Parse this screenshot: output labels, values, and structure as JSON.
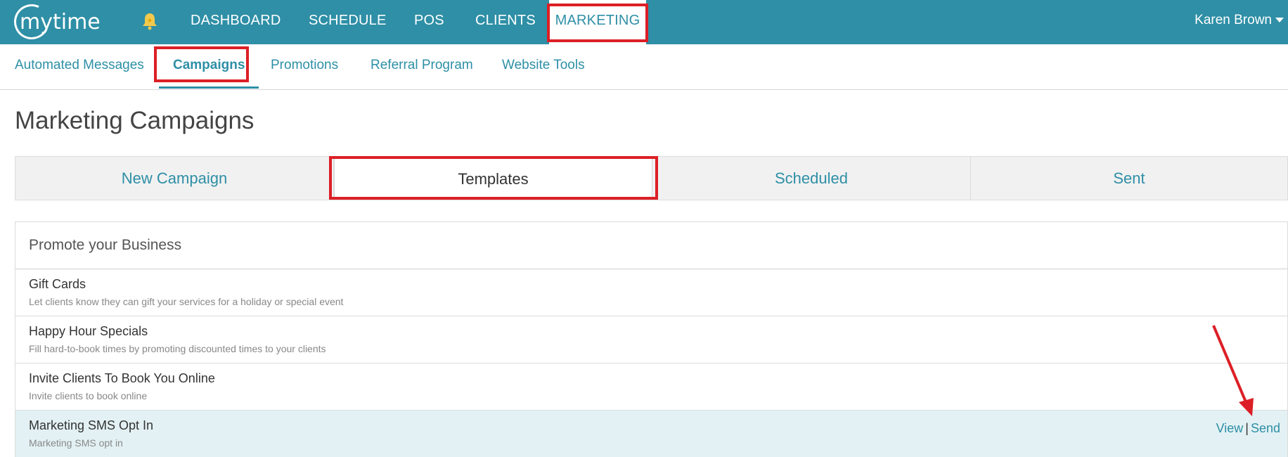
{
  "brand": {
    "logo_text": "mytime",
    "color": "#2e8fa6",
    "bell_icon": "bell-icon",
    "bell_color": "#f2c94c"
  },
  "topnav": {
    "items": [
      {
        "label": "DASHBOARD"
      },
      {
        "label": "SCHEDULE"
      },
      {
        "label": "POS"
      },
      {
        "label": "CLIENTS"
      },
      {
        "label": "MARKETING",
        "active": true
      }
    ],
    "user": "Karen Brown"
  },
  "subnav": {
    "items": [
      {
        "label": "Automated Messages"
      },
      {
        "label": "Campaigns",
        "active": true
      },
      {
        "label": "Promotions"
      },
      {
        "label": "Referral Program"
      },
      {
        "label": "Website Tools"
      }
    ]
  },
  "page": {
    "title": "Marketing Campaigns"
  },
  "tabs": [
    {
      "label": "New Campaign"
    },
    {
      "label": "Templates",
      "active": true
    },
    {
      "label": "Scheduled"
    },
    {
      "label": "Sent"
    }
  ],
  "section": {
    "header": "Promote your Business",
    "rows": [
      {
        "title": "Gift Cards",
        "desc": "Let clients know they can gift your services for a holiday or special event"
      },
      {
        "title": "Happy Hour Specials",
        "desc": "Fill hard-to-book times by promoting discounted times to your clients"
      },
      {
        "title": "Invite Clients To Book You Online",
        "desc": "Invite clients to book online"
      },
      {
        "title": "Marketing SMS Opt In",
        "desc": "Marketing SMS opt in",
        "selected": true,
        "view_label": "View",
        "separator": "|",
        "send_label": "Send"
      }
    ]
  },
  "annotation_color": "#dc1f26"
}
